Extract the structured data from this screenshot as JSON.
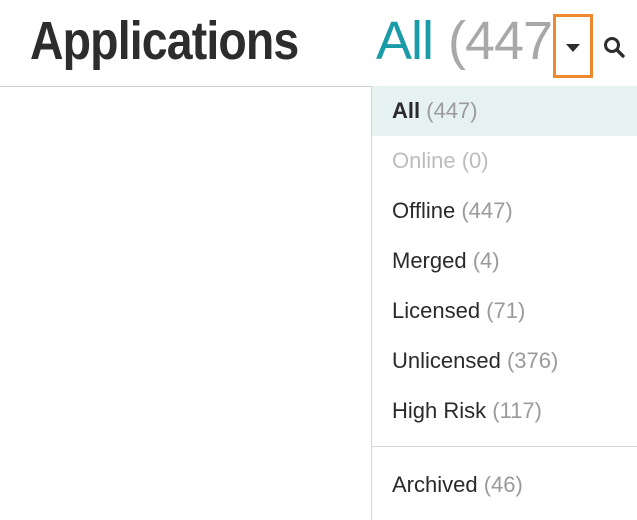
{
  "header": {
    "title": "Applications",
    "filter": "All",
    "count": "(447)"
  },
  "menu": {
    "items": [
      {
        "label": "All",
        "count": "(447)",
        "state": "active"
      },
      {
        "label": "Online",
        "count": "(0)",
        "state": "disabled"
      },
      {
        "label": "Offline",
        "count": "(447)",
        "state": "normal"
      },
      {
        "label": "Merged",
        "count": "(4)",
        "state": "normal"
      },
      {
        "label": "Licensed",
        "count": "(71)",
        "state": "normal"
      },
      {
        "label": "Unlicensed",
        "count": "(376)",
        "state": "normal"
      },
      {
        "label": "High Risk",
        "count": "(117)",
        "state": "normal"
      }
    ],
    "archived": {
      "label": "Archived",
      "count": "(46)"
    }
  },
  "icons": {
    "dropdown": "caret-down-icon",
    "search": "search-icon"
  },
  "colors": {
    "accent": "#1a9ba8",
    "highlight_border": "#f0882d",
    "active_bg": "#e6f2f1"
  }
}
